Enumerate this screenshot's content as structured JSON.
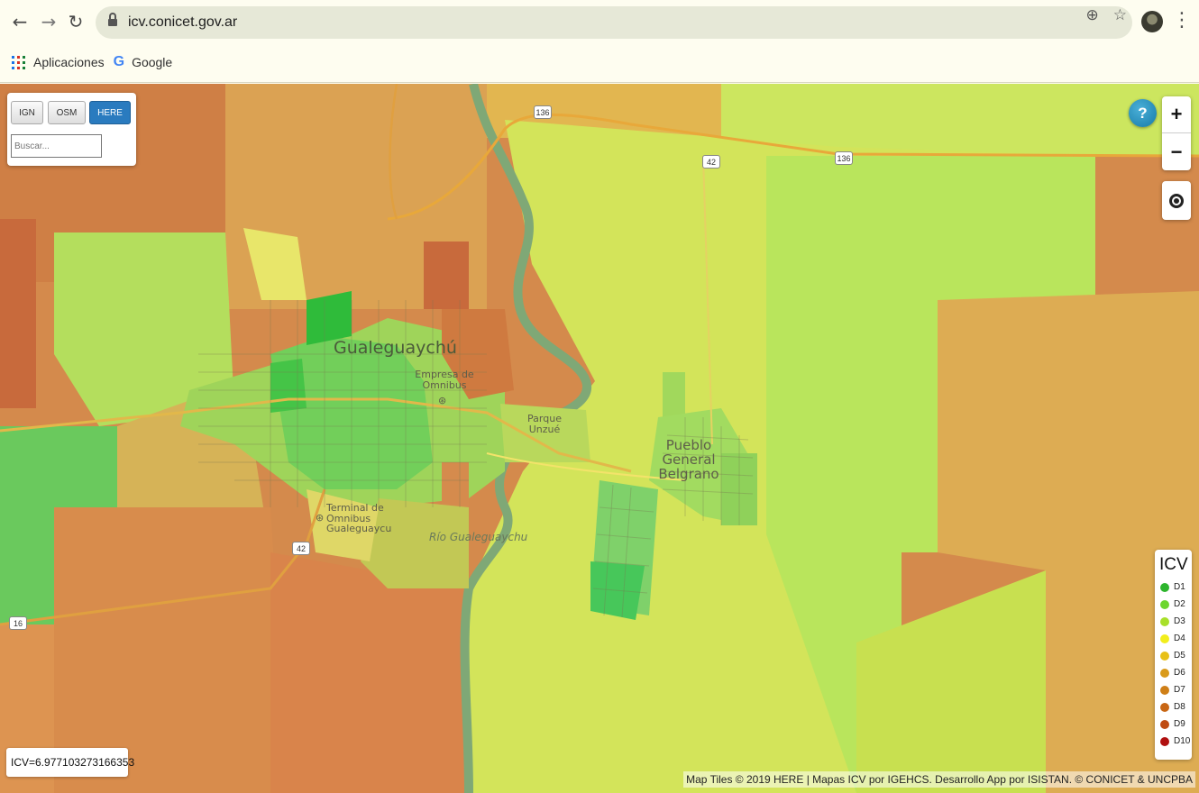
{
  "browser": {
    "url": "icv.conicet.gov.ar",
    "bookmarks": [
      {
        "label": "Aplicaciones"
      },
      {
        "label": "Google"
      }
    ]
  },
  "layers": {
    "buttons": [
      "IGN",
      "OSM",
      "HERE"
    ],
    "active": "HERE",
    "search_placeholder": "Buscar..."
  },
  "controls": {
    "help_label": "?",
    "zoom_in": "+",
    "zoom_out": "−"
  },
  "map_labels": {
    "city": "Gualeguaychú",
    "bus_station": "Empresa de Omnibus",
    "terminal": "Terminal de Omnibus Gualeguaycu",
    "park": "Parque Unzué",
    "river": "Río Gualeguaychu",
    "town": "Pueblo General Belgrano",
    "route_shields": [
      "136",
      "42",
      "136",
      "42",
      "16"
    ]
  },
  "legend": {
    "title": "ICV",
    "items": [
      {
        "label": "D1",
        "color": "#2db52d"
      },
      {
        "label": "D2",
        "color": "#6cd62e"
      },
      {
        "label": "D3",
        "color": "#a8e02a"
      },
      {
        "label": "D4",
        "color": "#f2ee1c"
      },
      {
        "label": "D5",
        "color": "#e8c017"
      },
      {
        "label": "D6",
        "color": "#d99a1a"
      },
      {
        "label": "D7",
        "color": "#cf7f17"
      },
      {
        "label": "D8",
        "color": "#c86614"
      },
      {
        "label": "D9",
        "color": "#bf4c12"
      },
      {
        "label": "D10",
        "color": "#b01010"
      }
    ]
  },
  "icv_readout": "ICV=6.977103273166353",
  "attribution": "Map Tiles © 2019 HERE | Mapas ICV por IGEHCS. Desarrollo App por ISISTAN. © CONICET & UNCPBA"
}
